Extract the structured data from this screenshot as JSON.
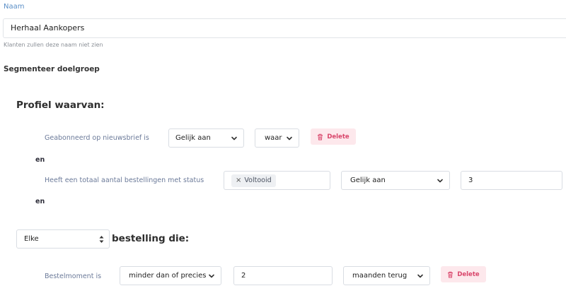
{
  "name_field": {
    "label": "Naam",
    "value": "Herhaal Aankopers",
    "helper": "Klanten zullen deze naam niet zien"
  },
  "segment": {
    "title": "Segmenteer doelgroep",
    "profile_title": "Profiel waarvan:",
    "conditions": [
      {
        "label": "Geabonneerd op nieuwsbrief is",
        "operator": "Gelijk aan",
        "value": "waar",
        "delete_label": "Delete"
      },
      {
        "label": "Heeft een totaal aantal bestellingen met status",
        "tag": "Voltooid",
        "operator": "Gelijk aan",
        "value": "3"
      }
    ],
    "connector": "en"
  },
  "order": {
    "quantifier": "Elke",
    "label": "bestelling die:",
    "condition": {
      "label": "Bestelmoment is",
      "operator": "minder dan of precies",
      "value": "2",
      "unit": "maanden terug",
      "delete_label": "Delete"
    }
  },
  "icons": {
    "delete": "trash-icon",
    "dropdown": "chevron-down-icon",
    "select_updown": "updown-icon",
    "tag_remove": "close-icon"
  },
  "colors": {
    "label_blue": "#5b8fc7",
    "delete_bg": "#fde8ec",
    "delete_text": "#d9466b"
  }
}
